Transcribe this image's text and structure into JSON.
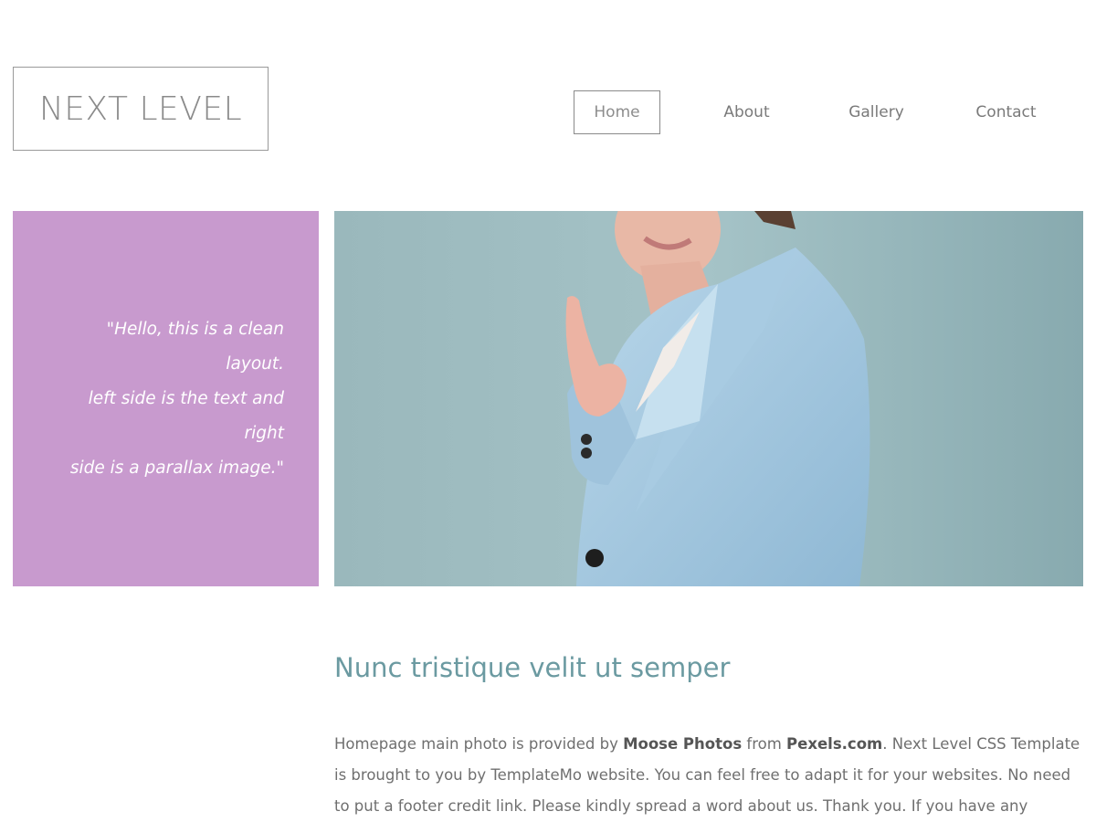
{
  "header": {
    "logo": "NEXT LEVEL",
    "nav": [
      {
        "label": "Home",
        "active": true
      },
      {
        "label": "About",
        "active": false
      },
      {
        "label": "Gallery",
        "active": false
      },
      {
        "label": "Contact",
        "active": false
      }
    ]
  },
  "hero": {
    "quote_line1": "\"Hello, this is a clean layout.",
    "quote_line2": "left side is the text and right",
    "quote_line3": "side is a parallax image.\"",
    "quote_bg_color": "#c89ace",
    "photo_bg_color": "#a3c2c6"
  },
  "content": {
    "title": "Nunc tristique velit ut semper",
    "body_part1": "Homepage main photo is provided by ",
    "body_bold1": "Moose Photos",
    "body_part2": " from ",
    "body_bold2": "Pexels.com",
    "body_part3": ". Next Level CSS Template is brought to you by TemplateMo website. You can feel free to adapt it for your websites. No need to put a footer credit link. Please kindly spread a word about us. Thank you. If you have any question, feel free",
    "title_color": "#6b9aa1"
  }
}
